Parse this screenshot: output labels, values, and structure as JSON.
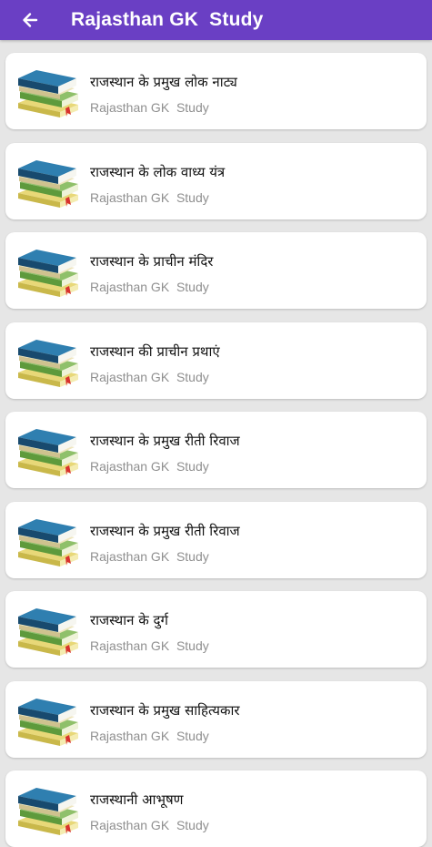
{
  "app_bar": {
    "title": "Rajasthan GK  Study",
    "back_icon": "arrow-left-icon",
    "color": "#6a3fc4"
  },
  "items": [
    {
      "title": "राजस्थान के प्रमुख लोक नाट्य",
      "subtitle": "Rajasthan GK  Study",
      "icon": "books-stack-icon"
    },
    {
      "title": "राजस्थान के लोक वाध्य यंत्र",
      "subtitle": "Rajasthan GK  Study",
      "icon": "books-stack-icon"
    },
    {
      "title": "राजस्थान के प्राचीन मंदिर",
      "subtitle": "Rajasthan GK  Study",
      "icon": "books-stack-icon"
    },
    {
      "title": "राजस्थान की प्राचीन प्रथाएं",
      "subtitle": "Rajasthan GK  Study",
      "icon": "books-stack-icon"
    },
    {
      "title": "राजस्थान के प्रमुख रीती रिवाज",
      "subtitle": "Rajasthan GK  Study",
      "icon": "books-stack-icon"
    },
    {
      "title": "राजस्थान के प्रमुख रीती रिवाज",
      "subtitle": "Rajasthan GK  Study",
      "icon": "books-stack-icon"
    },
    {
      "title": "राजस्थान के दुर्ग",
      "subtitle": "Rajasthan GK  Study",
      "icon": "books-stack-icon"
    },
    {
      "title": "राजस्थान के प्रमुख साहित्यकार",
      "subtitle": "Rajasthan GK  Study",
      "icon": "books-stack-icon"
    },
    {
      "title": "राजस्थानी आभूषण",
      "subtitle": "Rajasthan GK  Study",
      "icon": "books-stack-icon"
    }
  ]
}
